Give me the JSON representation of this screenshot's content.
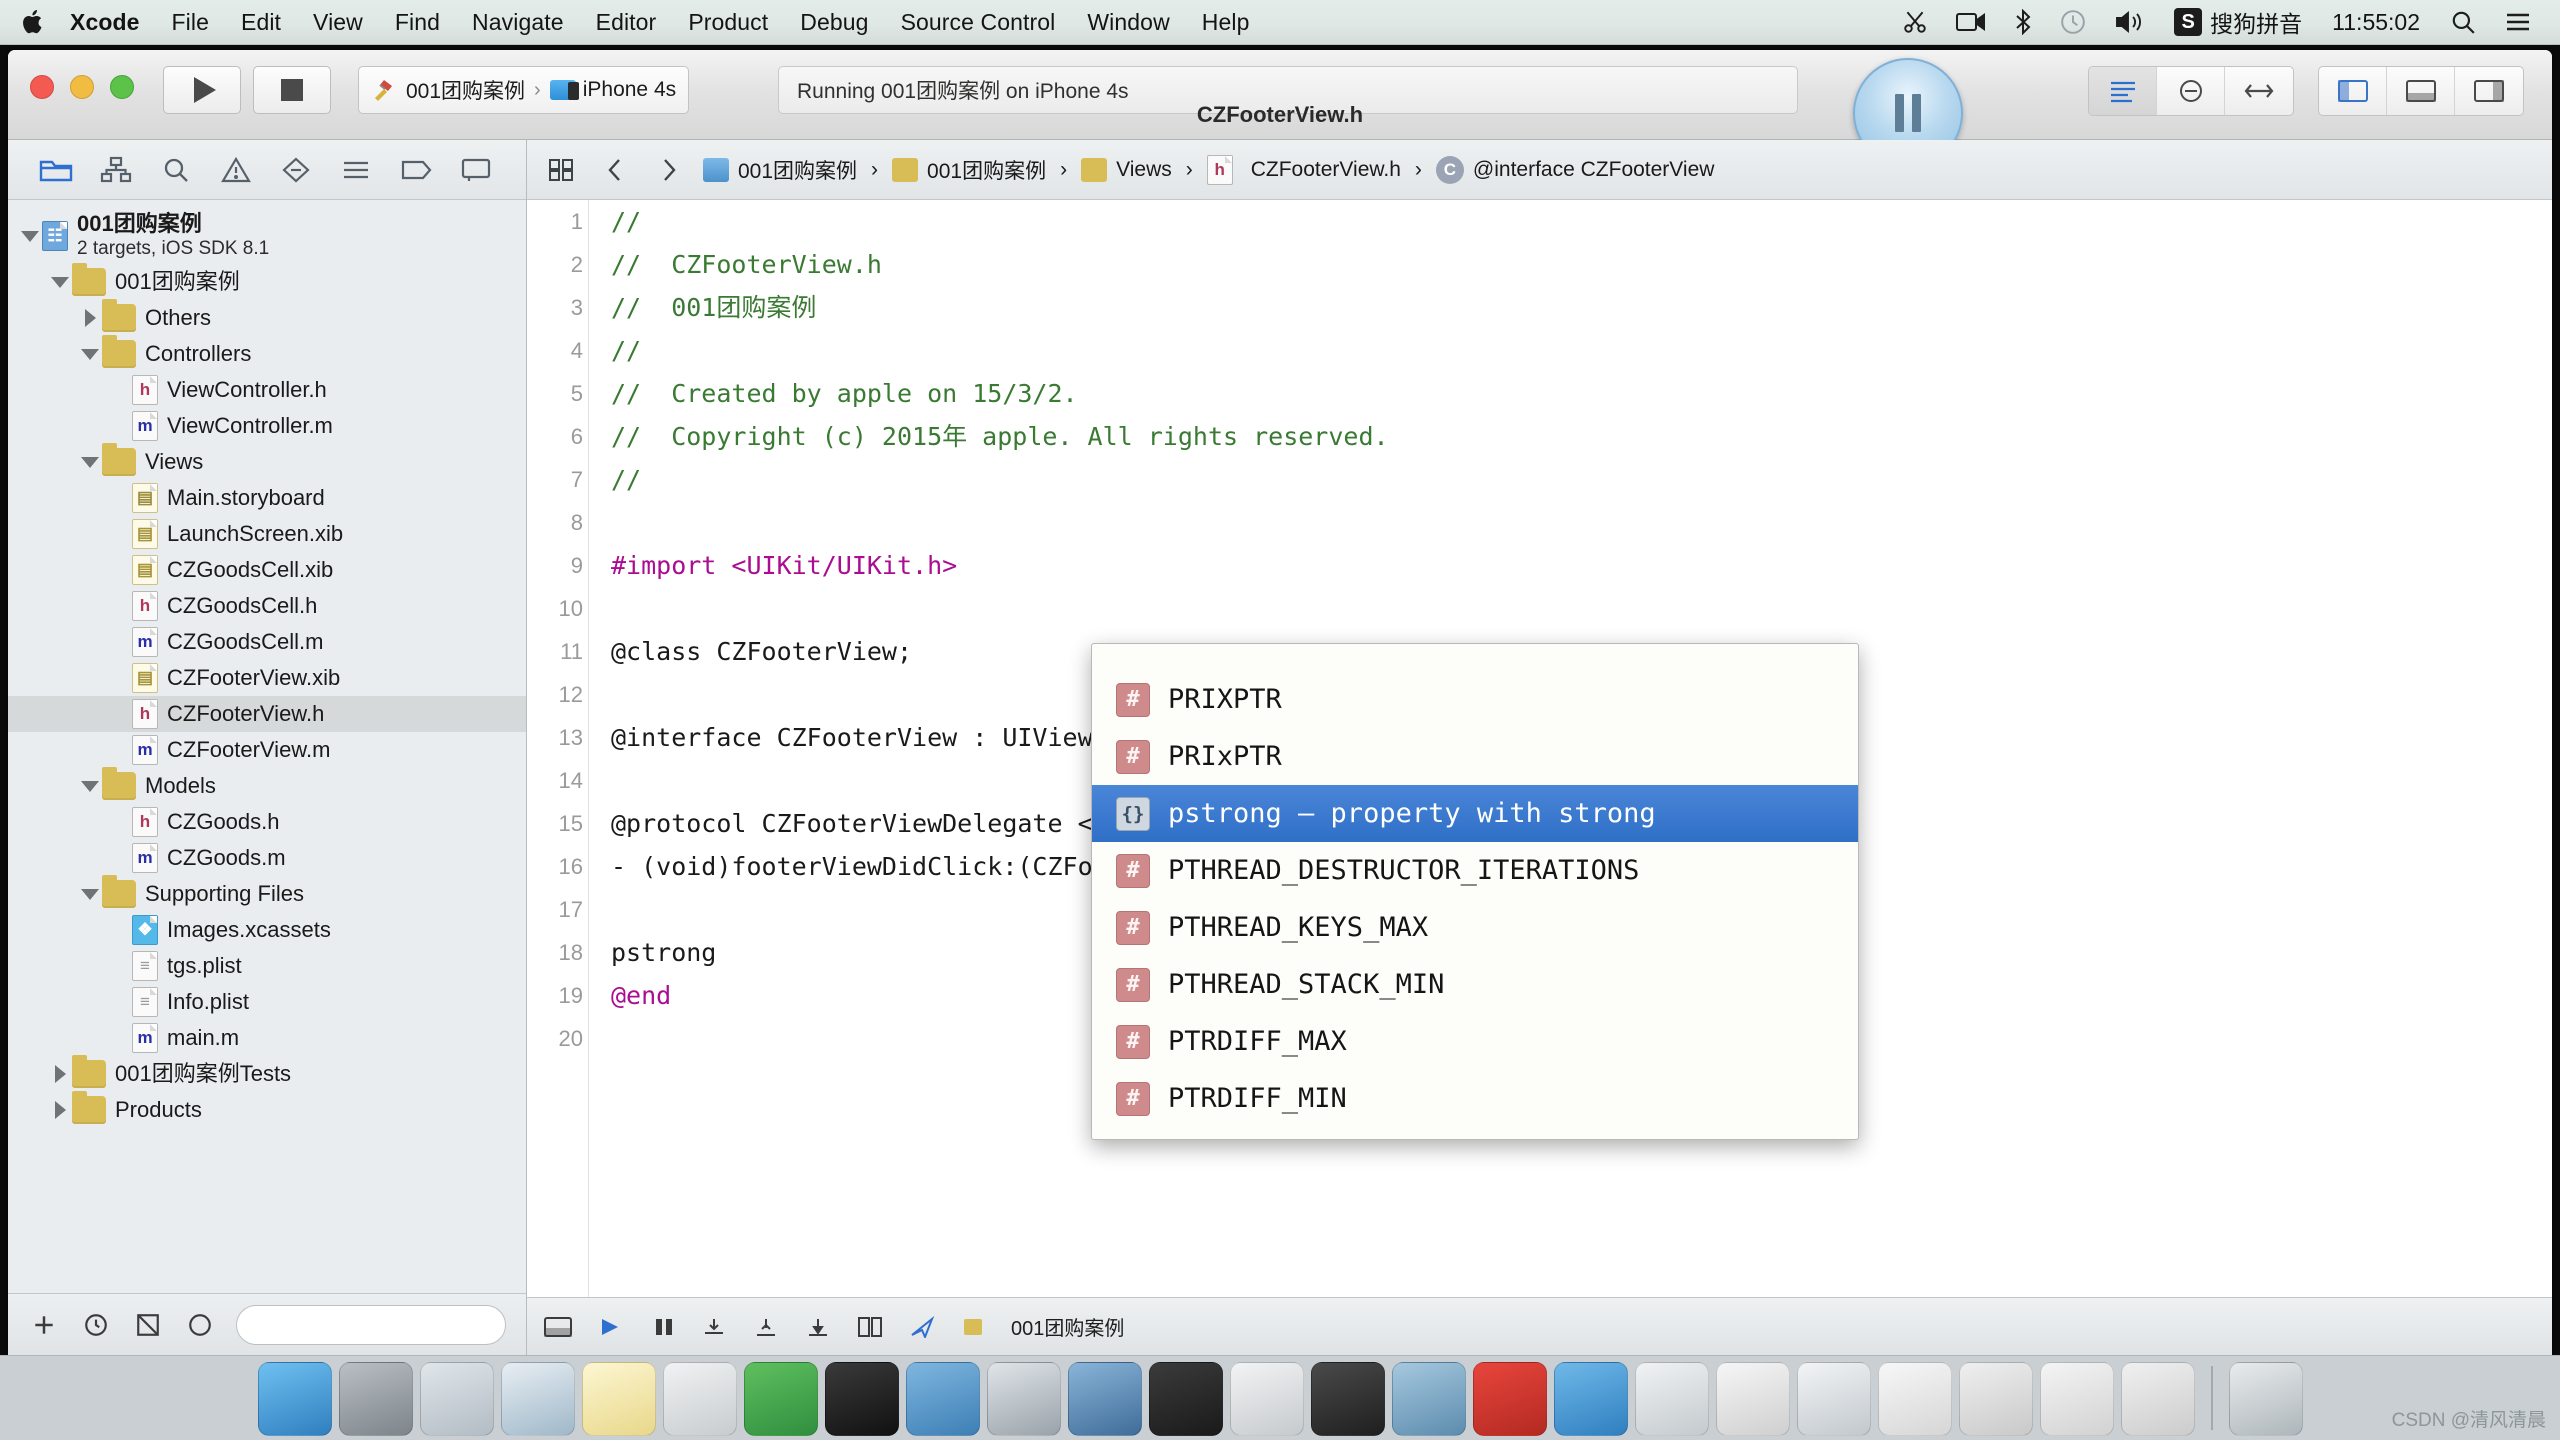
{
  "menubar": {
    "apple_icon": "apple-logo-icon",
    "items": [
      {
        "label": "Xcode",
        "bold": true
      },
      {
        "label": "File",
        "bold": false
      },
      {
        "label": "Edit",
        "bold": false
      },
      {
        "label": "View",
        "bold": false
      },
      {
        "label": "Find",
        "bold": false
      },
      {
        "label": "Navigate",
        "bold": false
      },
      {
        "label": "Editor",
        "bold": false
      },
      {
        "label": "Product",
        "bold": false
      },
      {
        "label": "Debug",
        "bold": false
      },
      {
        "label": "Source Control",
        "bold": false
      },
      {
        "label": "Window",
        "bold": false
      },
      {
        "label": "Help",
        "bold": false
      }
    ],
    "status_items": [
      {
        "name": "scissors-icon"
      },
      {
        "name": "screen-recording-icon"
      },
      {
        "name": "bluetooth-icon"
      },
      {
        "name": "time-machine-icon"
      },
      {
        "name": "volume-icon"
      }
    ],
    "input_method_badge": "S",
    "input_method_label": "搜狗拼音",
    "clock": "11:55:02",
    "search_icon": "search-icon",
    "notification_icon": "notification-center-icon"
  },
  "window": {
    "title": "CZFooterView.h",
    "run_button": "run-button",
    "stop_button": "stop-button",
    "scheme": {
      "project": "001团购案例",
      "separator": "›",
      "destination": "iPhone 4s"
    },
    "status_text": "Running 001团购案例 on iPhone 4s",
    "pause_button": "pause-button",
    "editor_mode_buttons": [
      "standard-editor-icon",
      "assistant-editor-icon",
      "version-editor-icon"
    ],
    "panel_buttons": [
      "toggle-navigator-icon",
      "toggle-debug-area-icon",
      "toggle-utilities-icon"
    ],
    "add_tab_label": "+"
  },
  "navigator": {
    "toolbar_icons": [
      "project-navigator-icon",
      "symbol-navigator-icon",
      "find-navigator-icon",
      "issue-navigator-icon",
      "test-navigator-icon",
      "debug-navigator-icon",
      "breakpoint-navigator-icon",
      "report-navigator-icon"
    ],
    "active_toolbar_icon": "project-navigator-icon",
    "tree": [
      {
        "label": "001团购案例",
        "sub": "2 targets, iOS SDK 8.1",
        "indent": 0,
        "twisty": "open",
        "icon": "proj",
        "bold": true
      },
      {
        "label": "001团购案例",
        "indent": 1,
        "twisty": "open",
        "icon": "folder"
      },
      {
        "label": "Others",
        "indent": 2,
        "twisty": "closed",
        "icon": "folder"
      },
      {
        "label": "Controllers",
        "indent": 2,
        "twisty": "open",
        "icon": "folder"
      },
      {
        "label": "ViewController.h",
        "indent": 3,
        "twisty": "none",
        "icon": "h"
      },
      {
        "label": "ViewController.m",
        "indent": 3,
        "twisty": "none",
        "icon": "m"
      },
      {
        "label": "Views",
        "indent": 2,
        "twisty": "open",
        "icon": "folder"
      },
      {
        "label": "Main.storyboard",
        "indent": 3,
        "twisty": "none",
        "icon": "sb"
      },
      {
        "label": "LaunchScreen.xib",
        "indent": 3,
        "twisty": "none",
        "icon": "xib"
      },
      {
        "label": "CZGoodsCell.xib",
        "indent": 3,
        "twisty": "none",
        "icon": "xib"
      },
      {
        "label": "CZGoodsCell.h",
        "indent": 3,
        "twisty": "none",
        "icon": "h"
      },
      {
        "label": "CZGoodsCell.m",
        "indent": 3,
        "twisty": "none",
        "icon": "m"
      },
      {
        "label": "CZFooterView.xib",
        "indent": 3,
        "twisty": "none",
        "icon": "xib"
      },
      {
        "label": "CZFooterView.h",
        "indent": 3,
        "twisty": "none",
        "icon": "h",
        "selected": true
      },
      {
        "label": "CZFooterView.m",
        "indent": 3,
        "twisty": "none",
        "icon": "m"
      },
      {
        "label": "Models",
        "indent": 2,
        "twisty": "open",
        "icon": "folder"
      },
      {
        "label": "CZGoods.h",
        "indent": 3,
        "twisty": "none",
        "icon": "h"
      },
      {
        "label": "CZGoods.m",
        "indent": 3,
        "twisty": "none",
        "icon": "m"
      },
      {
        "label": "Supporting Files",
        "indent": 2,
        "twisty": "open",
        "icon": "folder"
      },
      {
        "label": "Images.xcassets",
        "indent": 3,
        "twisty": "none",
        "icon": "assets"
      },
      {
        "label": "tgs.plist",
        "indent": 3,
        "twisty": "none",
        "icon": "plist"
      },
      {
        "label": "Info.plist",
        "indent": 3,
        "twisty": "none",
        "icon": "plist"
      },
      {
        "label": "main.m",
        "indent": 3,
        "twisty": "none",
        "icon": "m"
      },
      {
        "label": "001团购案例Tests",
        "indent": 1,
        "twisty": "closed",
        "icon": "folder"
      },
      {
        "label": "Products",
        "indent": 1,
        "twisty": "closed",
        "icon": "folder"
      }
    ],
    "footer": {
      "add_label": "+",
      "icons": [
        "add-icon",
        "recent-files-icon",
        "source-control-filter-icon",
        "filter-clear-icon"
      ],
      "filter_placeholder": ""
    }
  },
  "jumpbar": {
    "related_items_icon": "related-items-icon",
    "back_icon": "back-chevron-icon",
    "forward_icon": "forward-chevron-icon",
    "crumbs": [
      {
        "label": "001团购案例",
        "icon": "project-icon"
      },
      {
        "label": "001团购案例",
        "icon": "folder-icon"
      },
      {
        "label": "Views",
        "icon": "folder-icon"
      },
      {
        "label": "CZFooterView.h",
        "icon": "header-file-icon"
      },
      {
        "label": "@interface CZFooterView",
        "icon": "interface-badge"
      }
    ]
  },
  "code": {
    "lines": [
      {
        "num": "1",
        "segments": [
          {
            "t": "//",
            "c": "cm"
          }
        ]
      },
      {
        "num": "2",
        "segments": [
          {
            "t": "//  CZFooterView.h",
            "c": "cm"
          }
        ]
      },
      {
        "num": "3",
        "segments": [
          {
            "t": "//  001团购案例",
            "c": "cm"
          }
        ]
      },
      {
        "num": "4",
        "segments": [
          {
            "t": "//",
            "c": "cm"
          }
        ]
      },
      {
        "num": "5",
        "segments": [
          {
            "t": "//  Created by apple on 15/3/2.",
            "c": "cm"
          }
        ]
      },
      {
        "num": "6",
        "segments": [
          {
            "t": "//  Copyright (c) 2015年 apple. All rights reserved.",
            "c": "cm"
          }
        ]
      },
      {
        "num": "7",
        "segments": [
          {
            "t": "//",
            "c": "cm"
          }
        ]
      },
      {
        "num": "8",
        "segments": [
          {
            "t": "",
            "c": "pl"
          }
        ]
      },
      {
        "num": "9",
        "segments": [
          {
            "t": "#import <UIKit/UIKit.h>",
            "c": "kw"
          }
        ]
      },
      {
        "num": "10",
        "segments": [
          {
            "t": "",
            "c": "pl"
          }
        ]
      },
      {
        "num": "11",
        "segments": [
          {
            "t": "@class CZFooterView;",
            "c": "pl"
          }
        ]
      },
      {
        "num": "12",
        "segments": [
          {
            "t": "",
            "c": "pl"
          }
        ]
      },
      {
        "num": "13",
        "segments": [
          {
            "t": "@interface CZFooterView : UIView",
            "c": "pl"
          }
        ]
      },
      {
        "num": "14",
        "segments": [
          {
            "t": "",
            "c": "pl"
          }
        ]
      },
      {
        "num": "15",
        "segments": [
          {
            "t": "@protocol CZFooterViewDelegate <NSObject, UIScrollViewDelegate>",
            "c": "pl"
          }
        ]
      },
      {
        "num": "16",
        "segments": [
          {
            "t": "- (void)footerViewDidClick:(CZFooterView *)footerView;",
            "c": "pl"
          }
        ]
      },
      {
        "num": "17",
        "segments": [
          {
            "t": "",
            "c": "pl"
          }
        ]
      },
      {
        "num": "18",
        "segments": [
          {
            "t": "pstrong",
            "c": "pl"
          }
        ]
      },
      {
        "num": "19",
        "segments": [
          {
            "t": "@end",
            "c": "kw"
          }
        ]
      },
      {
        "num": "20",
        "segments": [
          {
            "t": "",
            "c": "pl"
          }
        ]
      }
    ]
  },
  "autocomplete": {
    "items": [
      {
        "label": "PRIXPTR",
        "kind": "macro"
      },
      {
        "label": "PRIxPTR",
        "kind": "macro"
      },
      {
        "label": "pstrong — property with strong",
        "kind": "snippet",
        "selected": true
      },
      {
        "label": "PTHREAD_DESTRUCTOR_ITERATIONS",
        "kind": "macro"
      },
      {
        "label": "PTHREAD_KEYS_MAX",
        "kind": "macro"
      },
      {
        "label": "PTHREAD_STACK_MIN",
        "kind": "macro"
      },
      {
        "label": "PTRDIFF_MAX",
        "kind": "macro"
      },
      {
        "label": "PTRDIFF_MIN",
        "kind": "macro"
      }
    ],
    "macro_glyph": "#",
    "snippet_glyph": "{}"
  },
  "editor_footer": {
    "scheme_label": "001团购案例",
    "icons": [
      "console-toggle-icon",
      "continue-icon",
      "step-over-icon",
      "step-into-icon",
      "step-out-icon",
      "simulate-location-icon",
      "view-hierarchy-icon",
      "process-icon"
    ]
  },
  "dock": {
    "apps": [
      {
        "name": "finder-icon",
        "color1": "#6fc0f0",
        "color2": "#2f7fc0"
      },
      {
        "name": "system-preferences-icon",
        "color1": "#b9bfc4",
        "color2": "#7d848a"
      },
      {
        "name": "launchpad-icon",
        "color1": "#e0e6ea",
        "color2": "#b2bcc4"
      },
      {
        "name": "safari-icon",
        "color1": "#e8eef3",
        "color2": "#9fb8c9"
      },
      {
        "name": "notes-icon",
        "color1": "#fdf6d2",
        "color2": "#e8d88a"
      },
      {
        "name": "scissors-app-icon",
        "color1": "#f0f2f3",
        "color2": "#c8ccce"
      },
      {
        "name": "evernote-icon",
        "color1": "#5fbf5f",
        "color2": "#2f8f3f"
      },
      {
        "name": "terminal-icon",
        "color1": "#3a3a3a",
        "color2": "#111111"
      },
      {
        "name": "downloads-icon",
        "color1": "#7fb6e0",
        "color2": "#3d7fb5"
      },
      {
        "name": "simulator-icon",
        "color1": "#dfe4e8",
        "color2": "#9aa3aa"
      },
      {
        "name": "xcode-icon",
        "color1": "#8ab4d8",
        "color2": "#3f6d99"
      },
      {
        "name": "pixelmator-icon",
        "color1": "#3b3b3b",
        "color2": "#1a1a1a"
      },
      {
        "name": "snipaste-icon",
        "color1": "#f2f3f4",
        "color2": "#c6cacd"
      },
      {
        "name": "quicktime-icon",
        "color1": "#4a4a4a",
        "color2": "#1f1f1f"
      },
      {
        "name": "screen-share-icon",
        "color1": "#a5c8df",
        "color2": "#5d8cae"
      },
      {
        "name": "filezilla-icon",
        "color1": "#e8453c",
        "color2": "#b32a22"
      },
      {
        "name": "app-store-icon",
        "color1": "#6fb8e8",
        "color2": "#2f7fc0"
      },
      {
        "name": "charts-icon",
        "color1": "#f0f2f4",
        "color2": "#c4cace"
      },
      {
        "name": "fontbook-icon",
        "color1": "#f6f6f6",
        "color2": "#cfcfcf"
      },
      {
        "name": "preview-icon",
        "color1": "#f2f4f6",
        "color2": "#c2c8cd"
      },
      {
        "name": "document-1-icon",
        "color1": "#f7f7f7",
        "color2": "#d6d6d6"
      },
      {
        "name": "document-2-icon",
        "color1": "#efefef",
        "color2": "#c9c9c9"
      },
      {
        "name": "document-3-icon",
        "color1": "#f4f4f4",
        "color2": "#d2d2d2"
      },
      {
        "name": "document-4-icon",
        "color1": "#f0f0f0",
        "color2": "#cccccc"
      },
      {
        "name": "trash-icon",
        "color1": "#e8ebed",
        "color2": "#aeb6bb"
      }
    ]
  },
  "watermark": "CSDN @清风清晨",
  "colors": {
    "accent_blue": "#2f6fc7",
    "comment_green": "#3a7a33",
    "keyword_magenta": "#aa0d91",
    "selection_gray": "#d6d9da"
  }
}
